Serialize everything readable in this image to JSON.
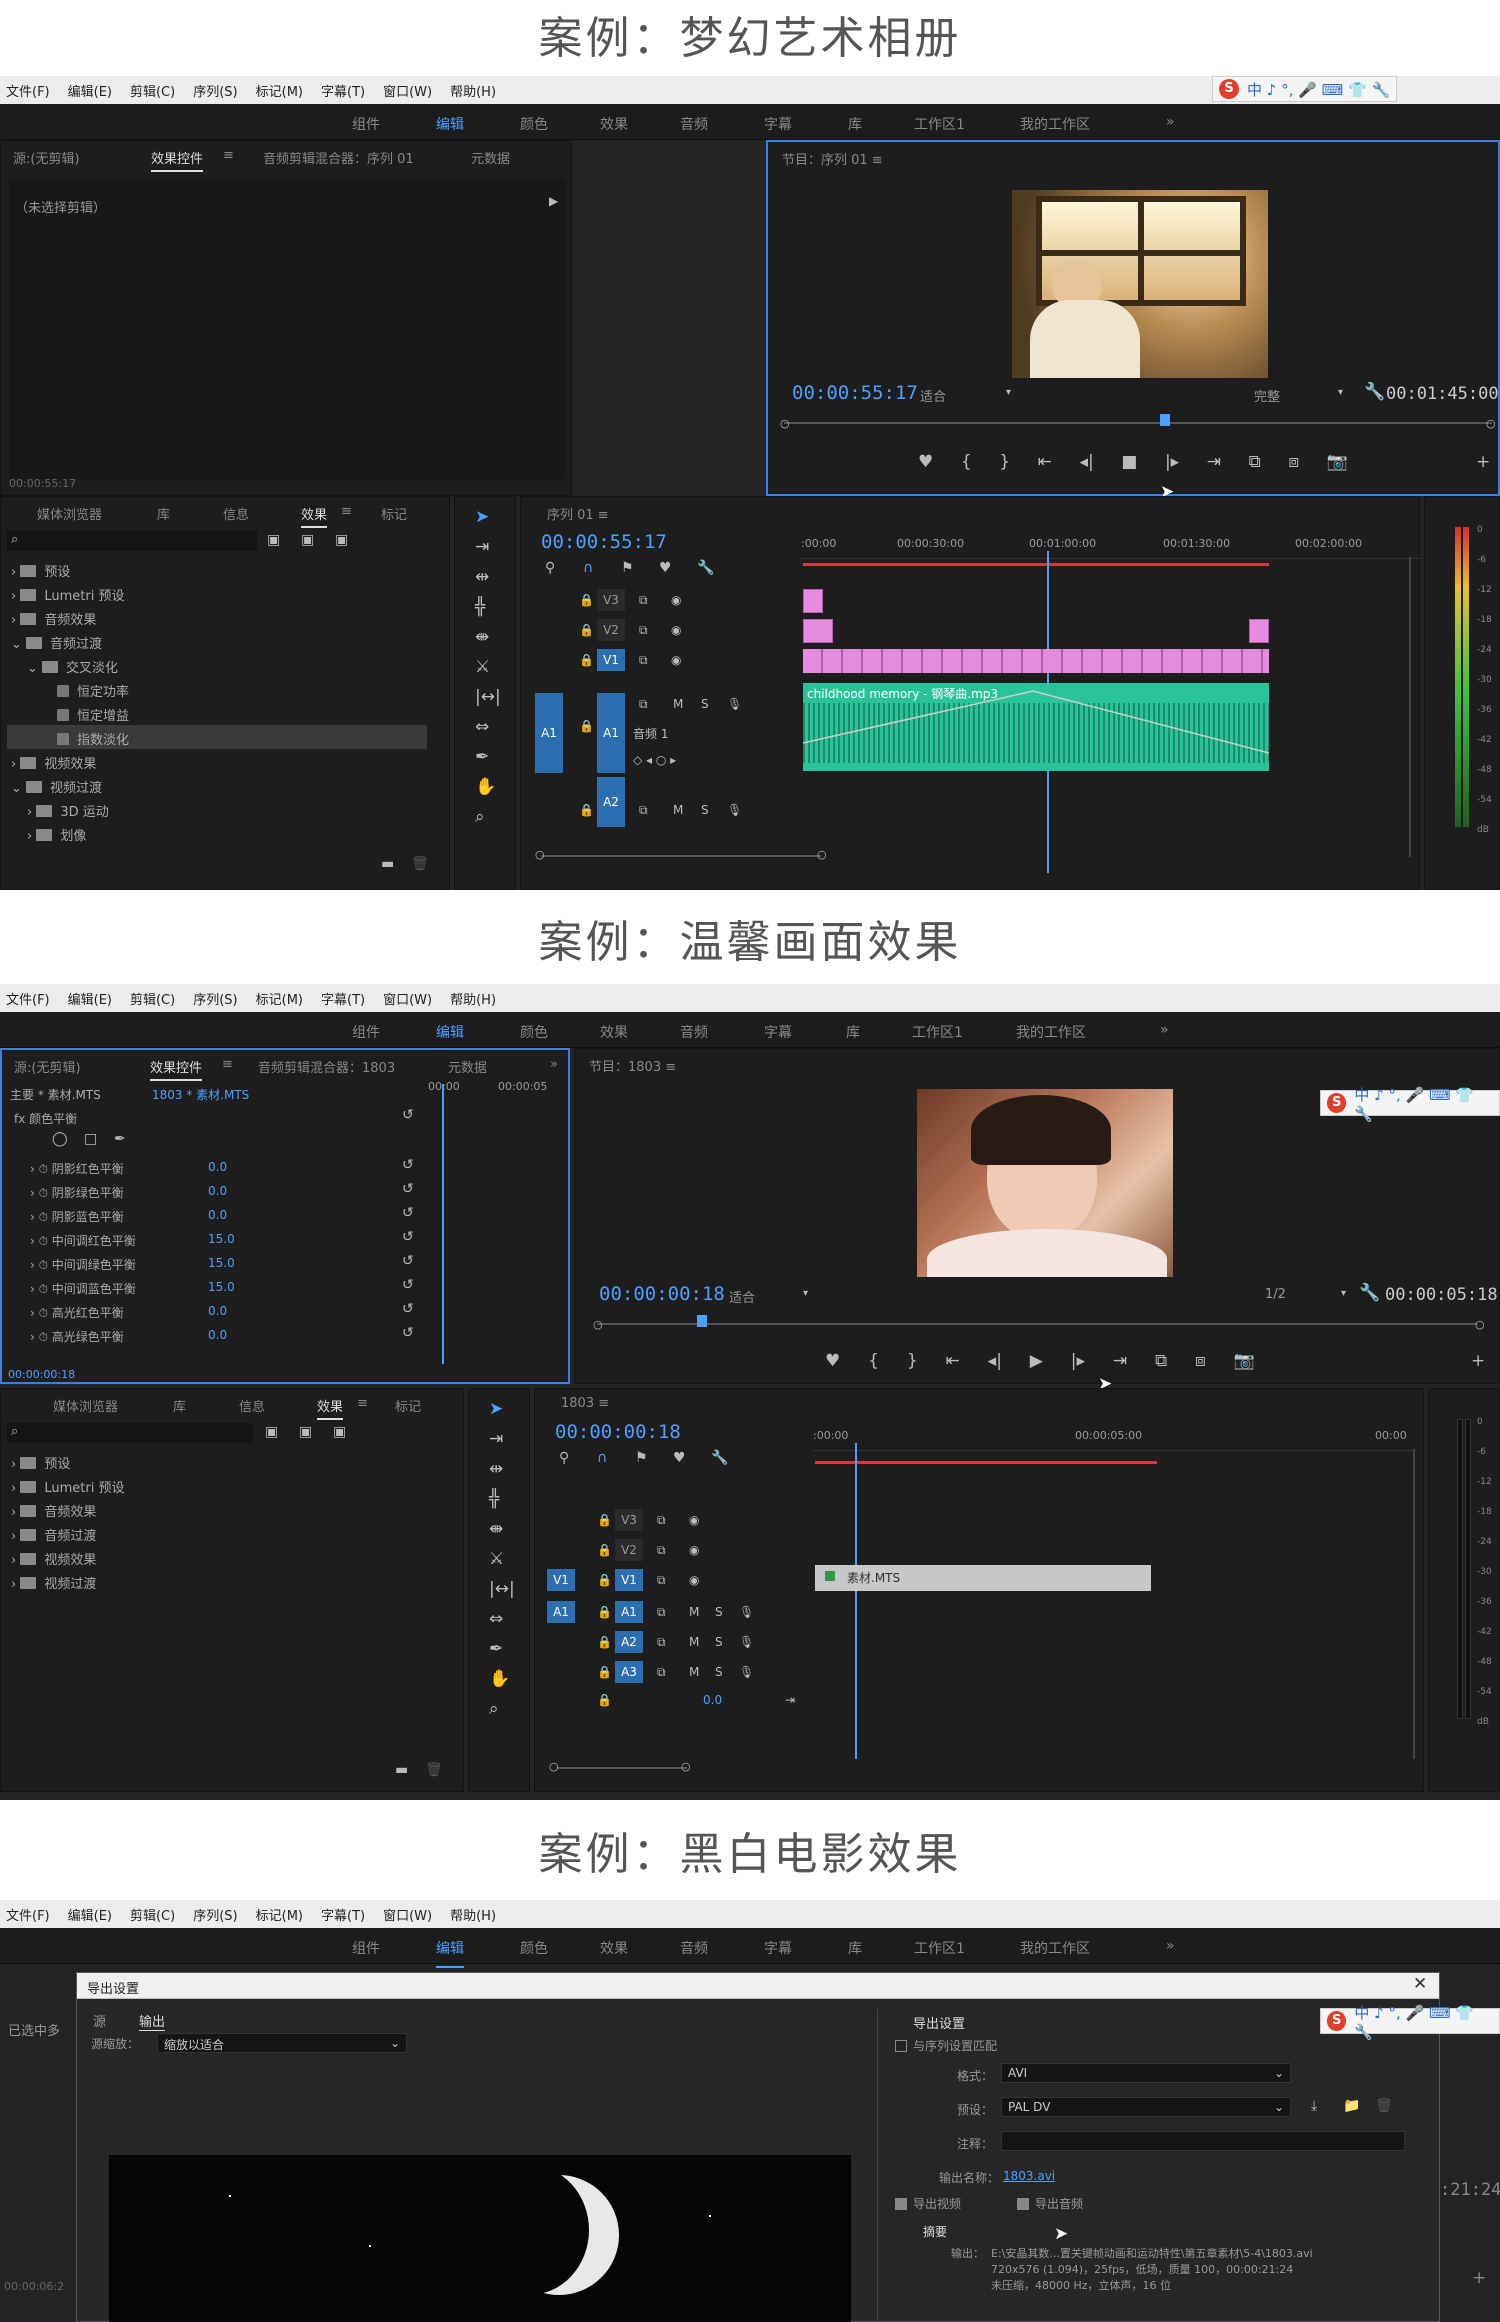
{
  "captions": [
    "案例：梦幻艺术相册",
    "案例：温馨画面效果",
    "案例：黑白电影效果"
  ],
  "menu": [
    "文件(F)",
    "编辑(E)",
    "剪辑(C)",
    "序列(S)",
    "标记(M)",
    "字幕(T)",
    "窗口(W)",
    "帮助(H)"
  ],
  "workspaces": [
    "组件",
    "编辑",
    "颜色",
    "效果",
    "音频",
    "字幕",
    "库",
    "工作区1",
    "我的工作区"
  ],
  "ws_more": "»",
  "sogou": {
    "logo": "S",
    "text": "中 ♪ °, 🎤 ⌨ 👕 🔧"
  },
  "s1": {
    "src_tabs": [
      "源:(无剪辑)",
      "效果控件",
      "≡",
      "音频剪辑混合器：序列 01",
      "元数据"
    ],
    "no_clip": "（未选择剪辑）",
    "src_tc": "00:00:55:17",
    "prog_title": "节目：序列 01 ≡",
    "prog_tc": "00:00:55:17",
    "fit": "适合",
    "quality": "完整",
    "duration": "00:01:45:00",
    "proj_tabs": [
      "媒体浏览器",
      "库",
      "信息",
      "效果",
      "≡",
      "标记"
    ],
    "tree": [
      "预设",
      "Lumetri 预设",
      "音频效果",
      "音频过渡",
      "交叉淡化",
      "恒定功率",
      "恒定增益",
      "指数淡化",
      "视频效果",
      "视频过渡",
      "3D 运动",
      "划像"
    ],
    "seq_title": "序列 01 ≡",
    "seq_tc": "00:00:55:17",
    "ruler": [
      ":00:00",
      "00:00:30:00",
      "00:01:00:00",
      "00:01:30:00",
      "00:02:00:00"
    ],
    "tracks": {
      "v3": "V3",
      "v2": "V2",
      "v1": "V1",
      "a1": "A1",
      "a2": "A2",
      "audio_name": "音频 1",
      "m": "M",
      "s": "S"
    },
    "audio_clip": "childhood memory - 钢琴曲.mp3",
    "meter_ticks": [
      "0",
      "-6",
      "-12",
      "-18",
      "-24",
      "-30",
      "-36",
      "-42",
      "-48",
      "-54",
      "dB"
    ]
  },
  "s2": {
    "src_tabs": [
      "源:(无剪辑)",
      "效果控件",
      "≡",
      "音频剪辑混合器：1803",
      "元数据"
    ],
    "master": "主要 * 素材.MTS",
    "clip": "1803 * 素材.MTS",
    "mini_ruler": [
      "00:00",
      "00:00:05"
    ],
    "fx": "fx  颜色平衡",
    "params": [
      {
        "n": "阴影红色平衡",
        "v": "0.0"
      },
      {
        "n": "阴影绿色平衡",
        "v": "0.0"
      },
      {
        "n": "阴影蓝色平衡",
        "v": "0.0"
      },
      {
        "n": "中间调红色平衡",
        "v": "15.0"
      },
      {
        "n": "中间调绿色平衡",
        "v": "15.0"
      },
      {
        "n": "中间调蓝色平衡",
        "v": "15.0"
      },
      {
        "n": "高光红色平衡",
        "v": "0.0"
      },
      {
        "n": "高光绿色平衡",
        "v": "0.0"
      }
    ],
    "src_tc": "00:00:00:18",
    "prog_title": "节目：1803 ≡",
    "prog_tc": "00:00:00:18",
    "fit": "适合",
    "quality": "1/2",
    "duration": "00:00:05:18",
    "proj_tabs": [
      "媒体浏览器",
      "库",
      "信息",
      "效果",
      "≡",
      "标记"
    ],
    "tree": [
      "预设",
      "Lumetri 预设",
      "音频效果",
      "音频过渡",
      "视频效果",
      "视频过渡"
    ],
    "seq_title": "1803 ≡",
    "seq_tc": "00:00:00:18",
    "ruler": [
      ":00:00",
      "00:00:05:00",
      "00:00"
    ],
    "tracks": {
      "v3": "V3",
      "v2": "V2",
      "v1": "V1",
      "a1": "A1",
      "a2": "A2",
      "a3": "A3",
      "m": "M",
      "s": "S",
      "vol": "0.0"
    },
    "clip_name": "素材.MTS",
    "meter_ticks": [
      "0",
      "-6",
      "-12",
      "-18",
      "-24",
      "-30",
      "-36",
      "-42",
      "-48",
      "-54",
      "dB"
    ]
  },
  "s3": {
    "dialog_title": "导出设置",
    "tabs": [
      "源",
      "输出"
    ],
    "scale_label": "源缩放：",
    "scale_val": "缩放以适合",
    "left_cut": "已选中多",
    "section": "导出设置",
    "match_seq": "与序列设置匹配",
    "format_label": "格式：",
    "format": "AVI",
    "preset_label": "预设：",
    "preset": "PAL DV",
    "comment_label": "注释：",
    "outname_label": "输出名称：",
    "outname": "1803.avi",
    "export_video": "导出视频",
    "export_audio": "导出音频",
    "summary": "摘要",
    "output_label": "输出：",
    "output_line1": "E:\\安晶其数...置关键帧动画和运动特性\\第五章素材\\5-4\\1803.avi",
    "output_line2": "720x576 (1.094)，25fps，低场，质量 100，00:00:21:24",
    "output_line3": "未压缩，48000 Hz，立体声，16 位",
    "right_tc": ":21:24",
    "left_tc": "00:00:06:2"
  }
}
